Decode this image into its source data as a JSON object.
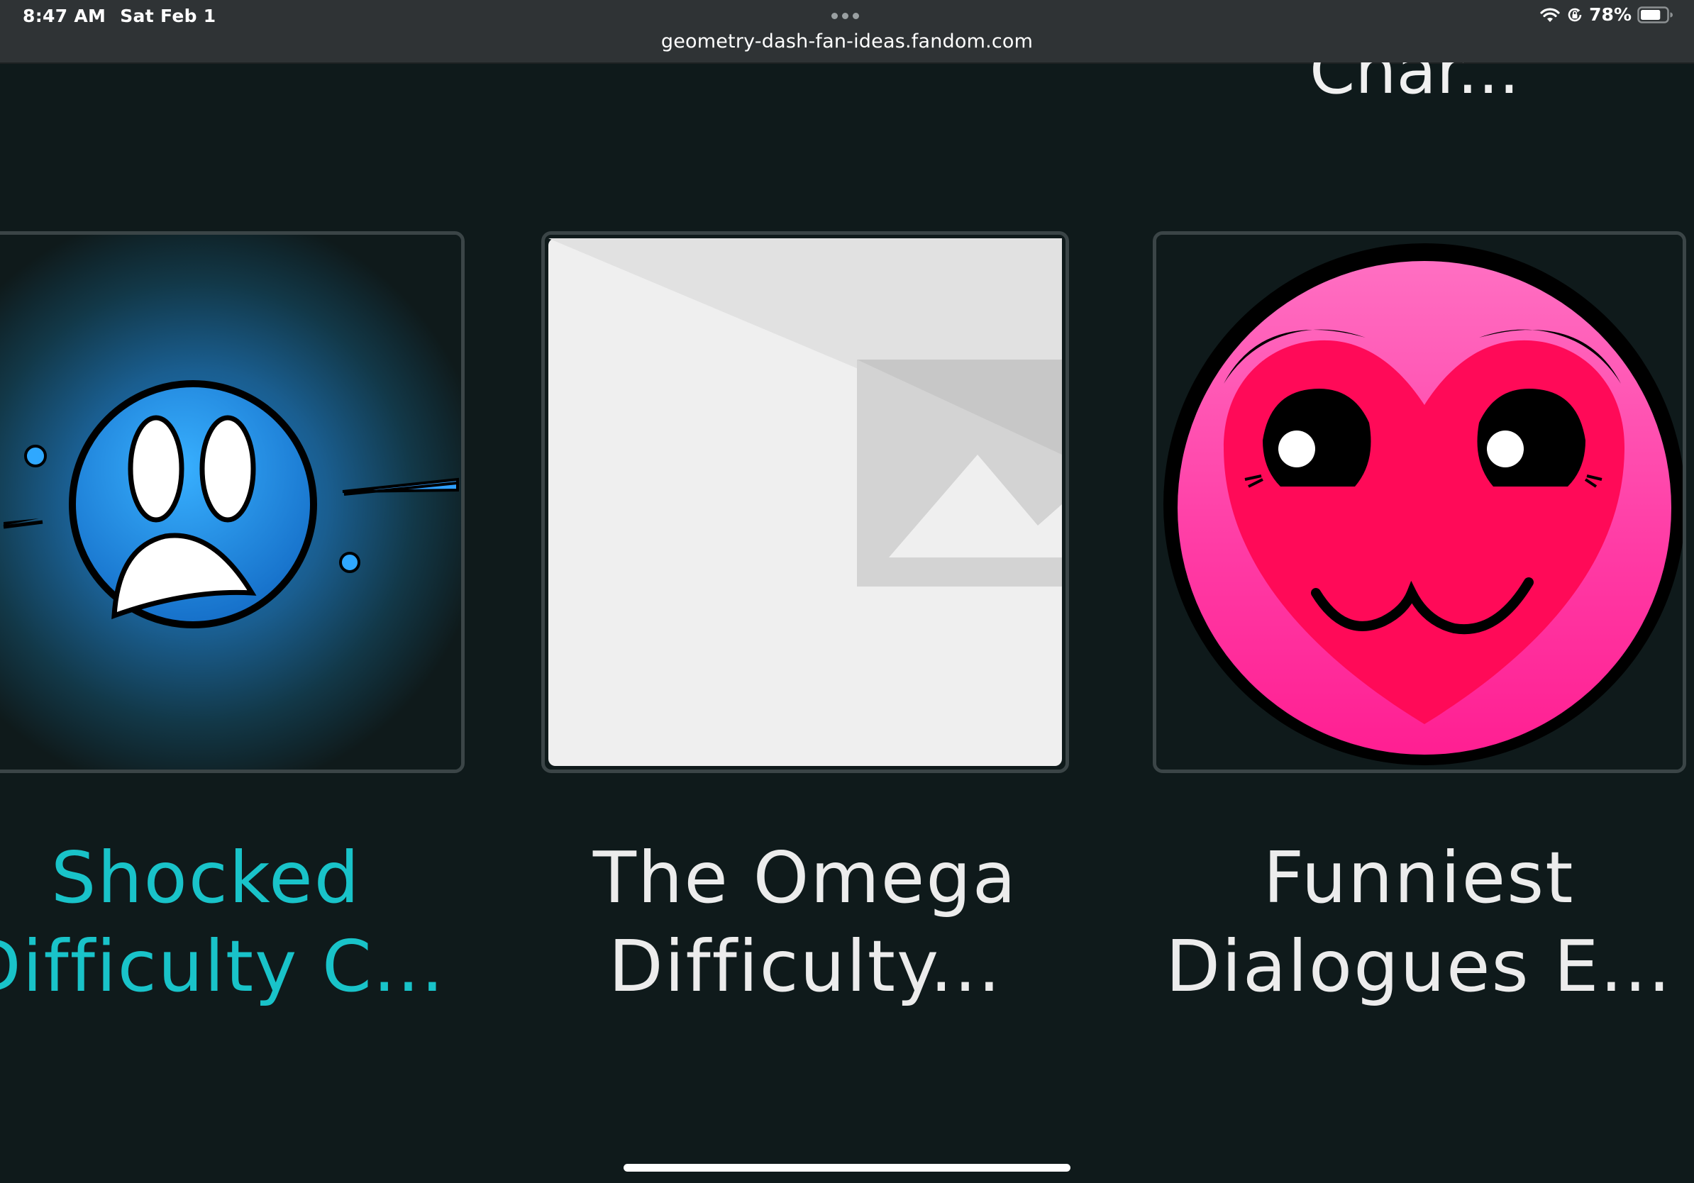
{
  "status_bar": {
    "time": "8:47 AM",
    "date": "Sat Feb 1",
    "battery_percent": "78%",
    "battery_level": 0.78,
    "icons": [
      "wifi-icon",
      "orientation-lock-icon",
      "battery-icon"
    ]
  },
  "browser": {
    "url": "geometry-dash-fan-ideas.fandom.com",
    "menu_icon": "more-dots-icon"
  },
  "carousel": {
    "partial_title": "Char...",
    "cards": [
      {
        "title_line1": "Shocked",
        "title_line2": "Difficulty C...",
        "image": "blue-shocked-face",
        "active": true
      },
      {
        "title_line1": "The Omega",
        "title_line2": "Difficulty...",
        "image": "placeholder-image-icon",
        "active": false
      },
      {
        "title_line1": "Funniest",
        "title_line2": "Dialogues E...",
        "image": "pink-heart-face",
        "active": false
      }
    ]
  },
  "colors": {
    "background": "#0f1a1b",
    "active_title": "#19c3c9",
    "title": "#ececec",
    "card_border": "#3b4547"
  }
}
